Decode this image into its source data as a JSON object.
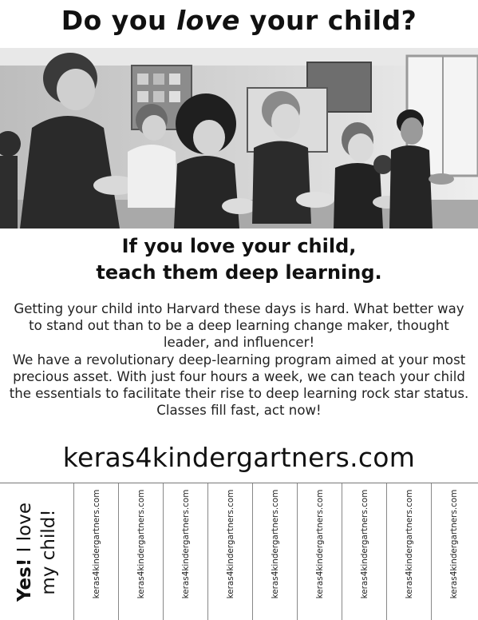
{
  "headline": {
    "before": "Do you ",
    "emphasis": "love",
    "after": " your child?"
  },
  "photo": {
    "icon": "classroom-children-photo"
  },
  "subheadline": {
    "line1": "If you love your child,",
    "line2": "teach them deep learning."
  },
  "paragraphs": [
    "Getting your child into Harvard these days is hard. What better way to stand out than to be a deep learning change maker, thought leader, and influencer!",
    "We have a revolutionary deep-learning program aimed at your most precious asset. With just four hours a week, we can teach your child the essentials to facilitate their rise to deep learning rock star status. Classes fill fast, act now!"
  ],
  "website": "keras4kindergartners.com",
  "tear_off": {
    "yes_bold": "Yes!",
    "yes_rest": " I love",
    "yes_line2": "my child!",
    "tabs": [
      "keras4kindergartners.com",
      "keras4kindergartners.com",
      "keras4kindergartners.com",
      "keras4kindergartners.com",
      "keras4kindergartners.com",
      "keras4kindergartners.com",
      "keras4kindergartners.com",
      "keras4kindergartners.com",
      "keras4kindergartners.com"
    ]
  }
}
